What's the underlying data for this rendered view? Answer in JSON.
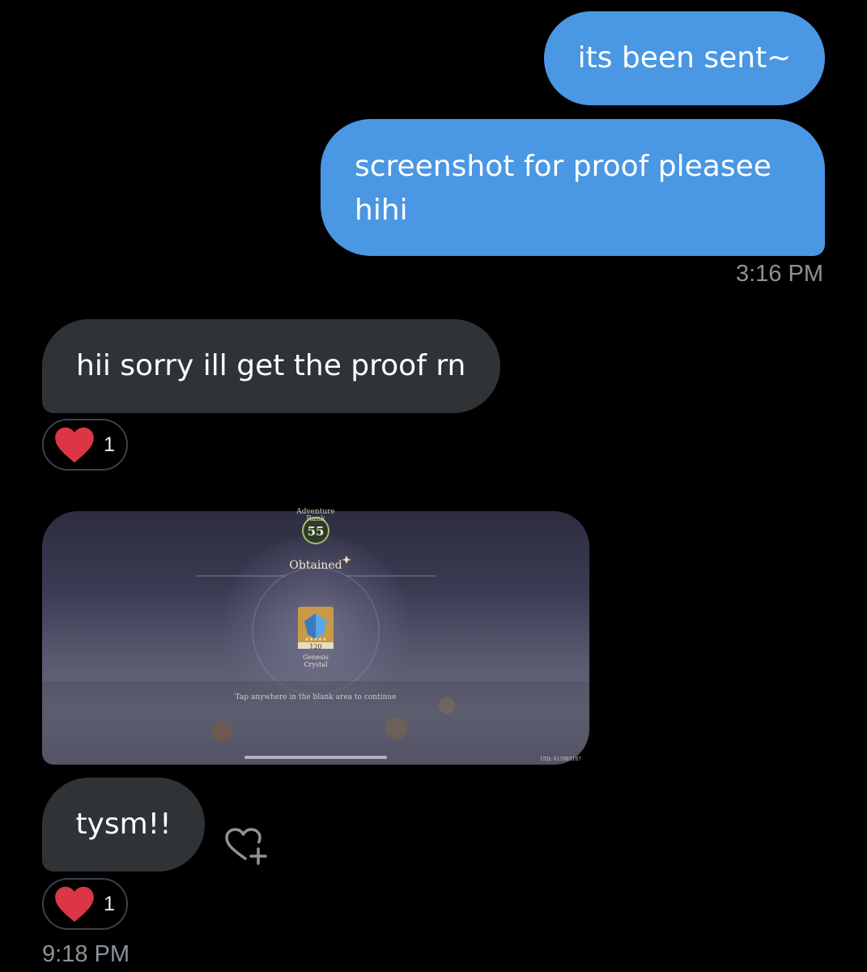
{
  "messages": {
    "sent_1": "its been sent~",
    "sent_2_line1": "screenshot for proof pleasee",
    "sent_2_line2": "hihi",
    "time_1": "3:16 PM",
    "received_1": "hii sorry ill get the proof rn",
    "received_1_reaction_count": "1",
    "received_2": "tysm!!",
    "received_2_reaction_count": "1",
    "time_2": "9:18 PM"
  },
  "attachment": {
    "adventure_label_1": "Adventure",
    "adventure_label_2": "Rank",
    "adventure_rank": "55",
    "obtained": "Obtained",
    "item_quantity": "120",
    "item_name_1": "Genesis",
    "item_name_2": "Crystal",
    "tap_hint": "Tap anywhere in the blank area to continue",
    "uid": "UID: 617085187"
  },
  "icons": {
    "reaction": "heart-icon",
    "add_reaction": "heart-plus-icon"
  },
  "colors": {
    "background": "#000000",
    "sent_bubble": "#4a97e3",
    "received_bubble": "#2f3336",
    "timestamp": "#8b9399",
    "heart": "#e0245e"
  }
}
